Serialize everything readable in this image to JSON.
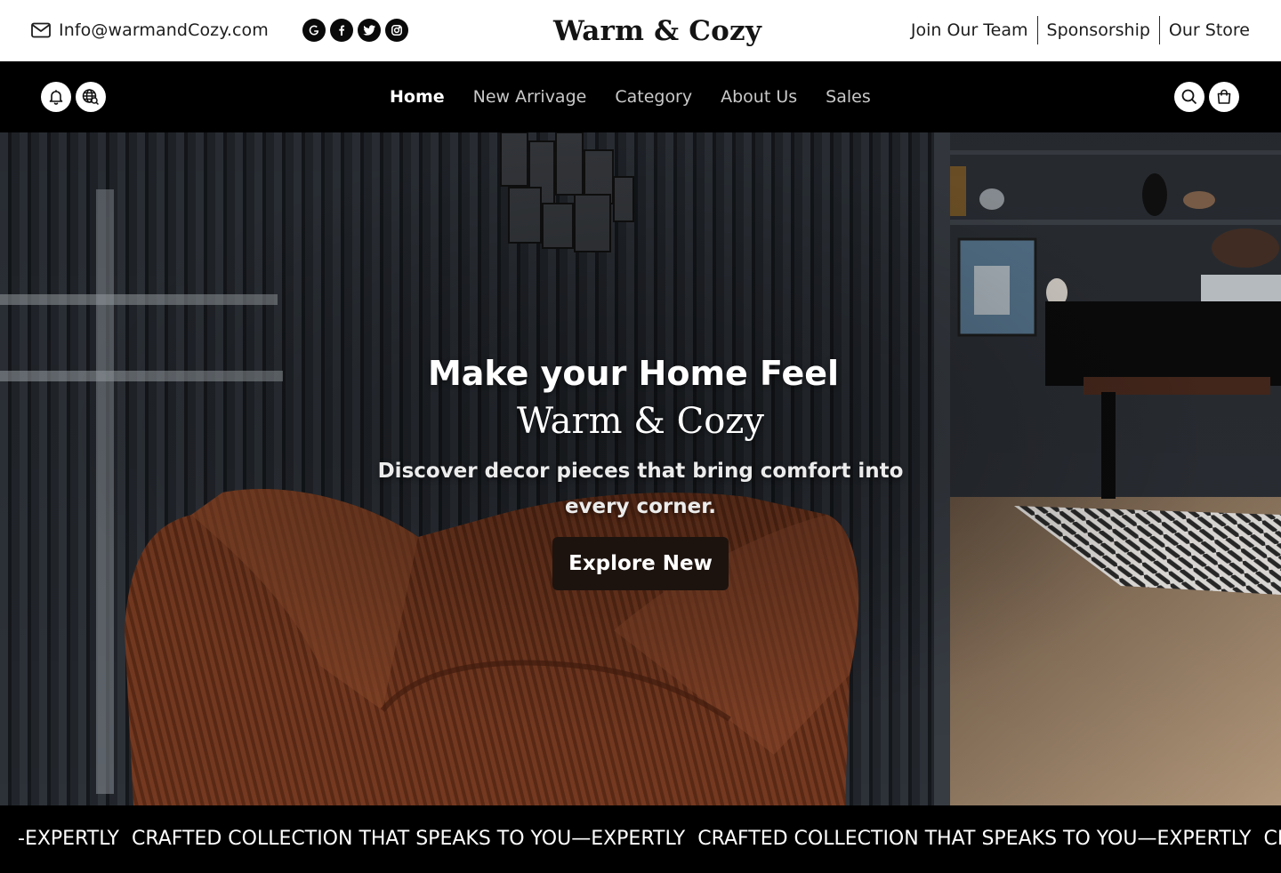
{
  "topbar": {
    "email": "Info@warmandCozy.com",
    "email_icon": "mail-icon",
    "socials": [
      {
        "name": "google",
        "icon": "google-icon"
      },
      {
        "name": "facebook",
        "icon": "facebook-icon"
      },
      {
        "name": "twitter",
        "icon": "twitter-icon"
      },
      {
        "name": "instagram",
        "icon": "instagram-icon"
      }
    ],
    "brand": "Warm & Cozy",
    "links": [
      "Join Our Team",
      "Sponsorship",
      "Our Store"
    ]
  },
  "navbar": {
    "left_icons": [
      "bell-icon",
      "globe-search-icon"
    ],
    "links": [
      "Home",
      "New Arrivage",
      "Category",
      "About Us",
      "Sales"
    ],
    "active_link": "Home",
    "right_icons": [
      "search-icon",
      "shopping-bag-icon"
    ]
  },
  "hero": {
    "headline": "Make your Home Feel",
    "headline_brand": "Warm & Cozy",
    "subtitle": "Discover decor pieces that bring comfort into every corner.",
    "cta_label": "Explore New"
  },
  "marquee": {
    "items": [
      "-EXPERTLY  CRAFTED COLLECTION THAT SPEAKS TO YOU",
      "—EXPERTLY  CRAFTED COLLECTION THAT SPEAKS TO YOU",
      "—EXPERTLY  CRAFTED COLLECTION THAT SPEAKS TO YOU"
    ]
  },
  "colors": {
    "topbar_bg": "#ffffff",
    "nav_bg": "#000000",
    "cta_bg": "#1c130f",
    "marquee_bg": "#000000",
    "armchair": "#7a3c22"
  }
}
